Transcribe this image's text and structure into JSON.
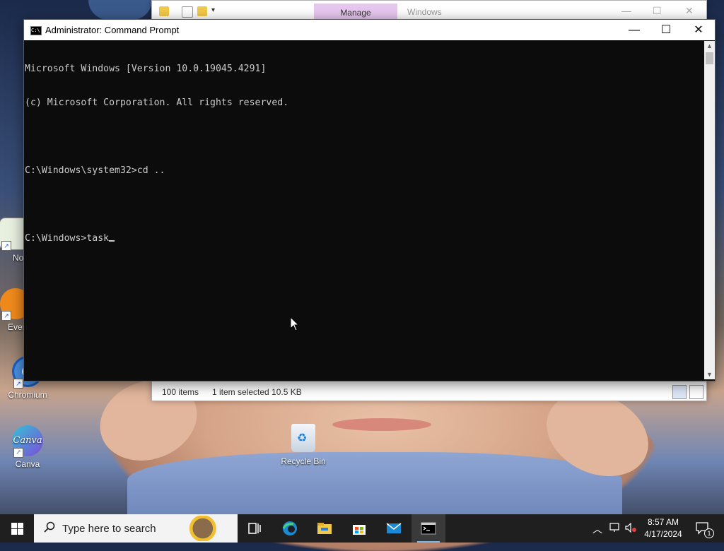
{
  "explorer": {
    "manage_tab": "Manage",
    "title": "Windows",
    "status_items": "100 items",
    "status_selected": "1 item selected  10.5 KB"
  },
  "cmd": {
    "title": "Administrator: Command Prompt",
    "lines": [
      "Microsoft Windows [Version 10.0.19045.4291]",
      "(c) Microsoft Corporation. All rights reserved.",
      "",
      "C:\\Windows\\system32>cd ..",
      "",
      "C:\\Windows>task"
    ]
  },
  "desktop": {
    "icons": [
      {
        "label": "Note",
        "icon": "notepad-icon"
      },
      {
        "label": "Ever",
        "icon": "everything-icon"
      },
      {
        "label": "Chromium",
        "icon": "chromium-icon"
      },
      {
        "label": "Canva",
        "icon": "canva-icon",
        "logo_text": "Canva"
      }
    ],
    "recycle_bin": "Recycle Bin"
  },
  "taskbar": {
    "search_placeholder": "Type here to search",
    "apps": [
      "task-view-icon",
      "edge-icon",
      "file-explorer-icon",
      "store-icon",
      "mail-icon",
      "command-prompt-icon"
    ],
    "time": "8:57 AM",
    "date": "4/17/2024",
    "notification_count": "1"
  },
  "colors": {
    "console_bg": "#0c0c0c",
    "console_text": "#cccccc",
    "taskbar": "#1f1f1f",
    "accent": "#76b9ed"
  }
}
